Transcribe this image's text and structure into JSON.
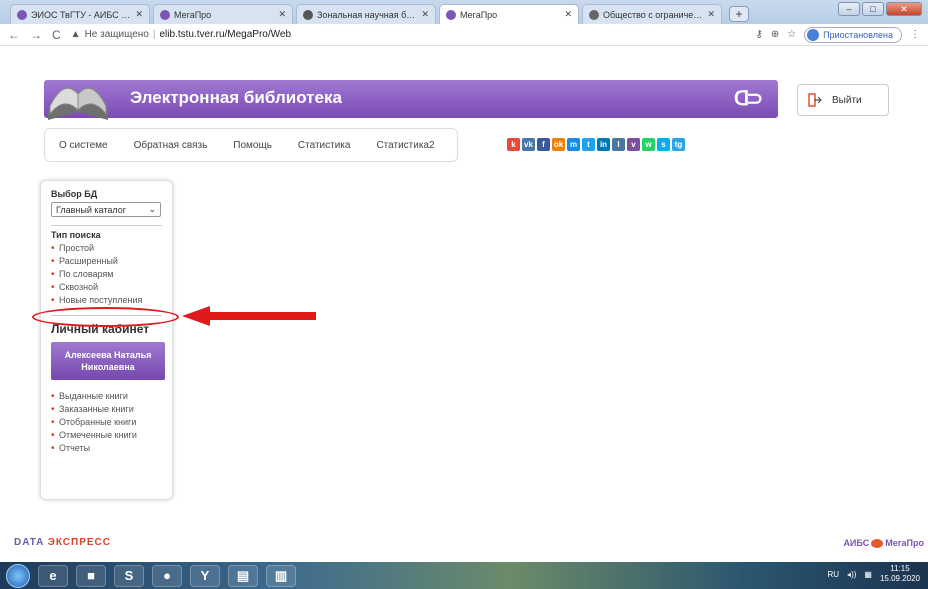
{
  "browser": {
    "tabs": [
      {
        "label": "ЭИОС ТвГТУ - АИБС МегаПро",
        "active": false,
        "icon_color": "#7a56b5"
      },
      {
        "label": "МегаПро",
        "active": false,
        "icon_color": "#7a56b5"
      },
      {
        "label": "Зональная научная библиотек",
        "active": false,
        "icon_color": "#555555"
      },
      {
        "label": "МегаПро",
        "active": true,
        "icon_color": "#7a56b5"
      },
      {
        "label": "Общество с ограниченной отв",
        "active": false,
        "icon_color": "#666666"
      }
    ],
    "new_tab": "+",
    "address": {
      "security": "Не защищено",
      "separator": "|",
      "url": "elib.tstu.tver.ru/MegaPro/Web"
    },
    "profile_label": "Приостановлена"
  },
  "page": {
    "title": "Электронная библиотека",
    "logout_label": "Выйти",
    "menu": [
      "О системе",
      "Обратная связь",
      "Помощь",
      "Статистика",
      "Статистика2"
    ],
    "social": [
      {
        "glyph": "k",
        "color": "#e84b3c"
      },
      {
        "glyph": "vk",
        "color": "#4a76a8"
      },
      {
        "glyph": "f",
        "color": "#3b5998"
      },
      {
        "glyph": "ok",
        "color": "#ee8208"
      },
      {
        "glyph": "m",
        "color": "#168de2"
      },
      {
        "glyph": "t",
        "color": "#1da1f2"
      },
      {
        "glyph": "in",
        "color": "#0077b5"
      },
      {
        "glyph": "l",
        "color": "#4c75a3"
      },
      {
        "glyph": "v",
        "color": "#7b519d"
      },
      {
        "glyph": "w",
        "color": "#25d366"
      },
      {
        "glyph": "s",
        "color": "#00aff0"
      },
      {
        "glyph": "tg",
        "color": "#2ca5e0"
      }
    ],
    "sidebar": {
      "db_heading": "Выбор БД",
      "db_selected": "Главный каталог",
      "search_heading": "Тип поиска",
      "search_types": [
        "Простой",
        "Расширенный",
        "По словарям",
        "Сквозной",
        "Новые поступления"
      ],
      "cabinet_heading": "Личный кабинет",
      "user_name_line1": "Алексеева Наталья",
      "user_name_line2": "Николаевна",
      "cabinet_items": [
        "Выданные книги",
        "Заказанные книги",
        "Отобранные книги",
        "Отмеченные книги",
        "Отчеты"
      ]
    },
    "footer": {
      "left_logo_a": "DATA",
      "left_logo_b": "ЭКСПРЕСС",
      "right_logo_a": "АИБС",
      "right_logo_b": "МегаПро"
    }
  },
  "taskbar": {
    "items": [
      "e",
      "■",
      "S",
      "●",
      "Y",
      "▤",
      "▥"
    ],
    "lang": "RU",
    "time": "11:15",
    "date": "15.09.2020"
  }
}
